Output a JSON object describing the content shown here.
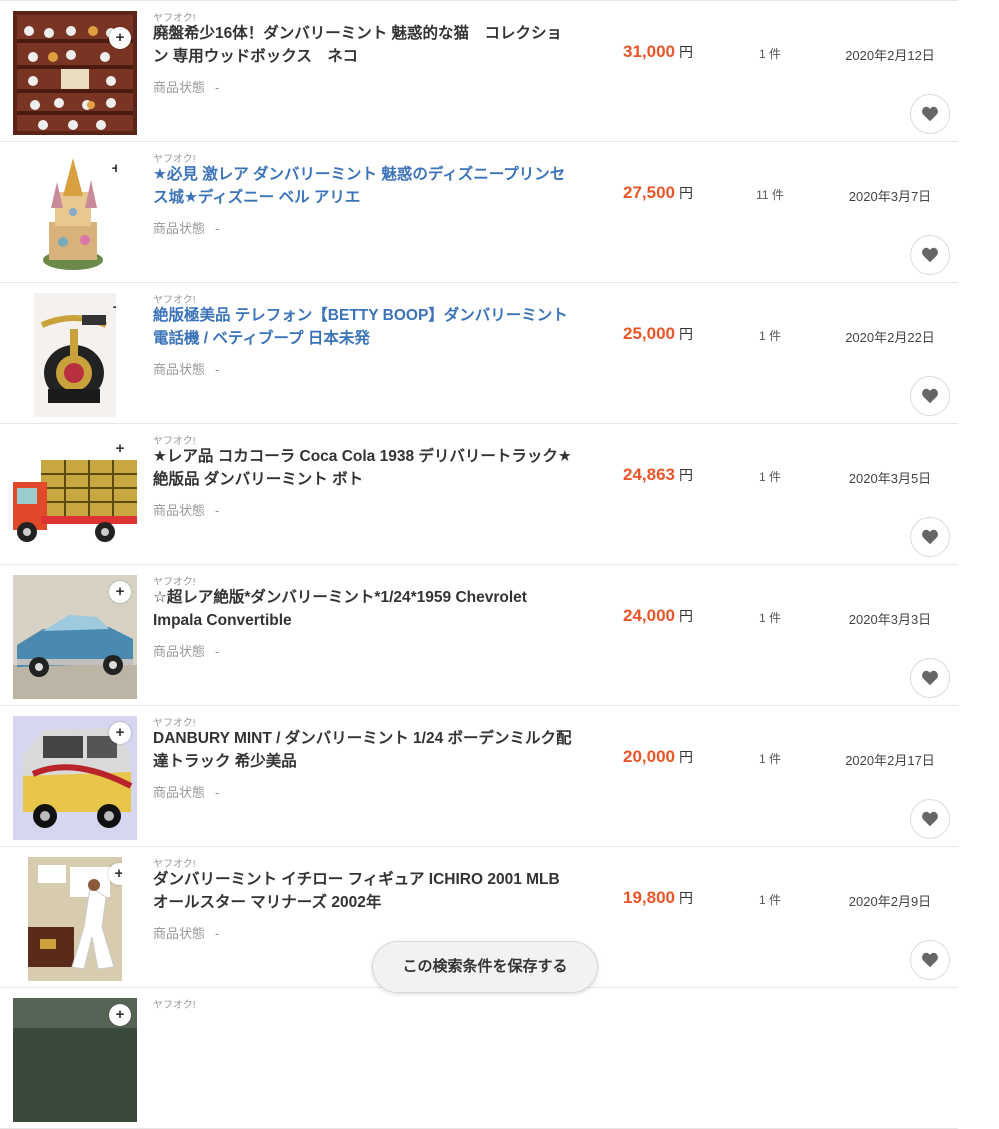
{
  "items": [
    {
      "source": "ヤフオク!",
      "title": "廃盤希少16体！ダンバリーミント 魅惑的な猫　コレクション 専用ウッドボックス　ネコ",
      "cond_label": "商品状態",
      "cond_value": "-",
      "price": "31,000",
      "yen": "円",
      "bids": "1 件",
      "date": "2020年2月12日"
    },
    {
      "source": "ヤフオク!",
      "title": "★必見 激レア ダンバリーミント 魅惑のディズニープリンセス城★ディズニー ベル アリエ",
      "cond_label": "商品状態",
      "cond_value": "-",
      "price": "27,500",
      "yen": "円",
      "bids": "11 件",
      "date": "2020年3月7日"
    },
    {
      "source": "ヤフオク!",
      "title": "絶版極美品 テレフォン【BETTY BOOP】ダンバリーミント 電話機 / ベティブープ 日本未発",
      "cond_label": "商品状態",
      "cond_value": "-",
      "price": "25,000",
      "yen": "円",
      "bids": "1 件",
      "date": "2020年2月22日"
    },
    {
      "source": "ヤフオク!",
      "title": "★レア品 コカコーラ Coca Cola 1938 デリバリートラック★絶版品 ダンバリーミント ボト",
      "cond_label": "商品状態",
      "cond_value": "-",
      "price": "24,863",
      "yen": "円",
      "bids": "1 件",
      "date": "2020年3月5日"
    },
    {
      "source": "ヤフオク!",
      "title": "☆超レア絶版*ダンバリーミント*1/24*1959 Chevrolet Impala Convertible",
      "cond_label": "商品状態",
      "cond_value": "-",
      "price": "24,000",
      "yen": "円",
      "bids": "1 件",
      "date": "2020年3月3日"
    },
    {
      "source": "ヤフオク!",
      "title": "DANBURY MINT / ダンバリーミント 1/24 ボーデンミルク配達トラック 希少美品",
      "cond_label": "商品状態",
      "cond_value": "-",
      "price": "20,000",
      "yen": "円",
      "bids": "1 件",
      "date": "2020年2月17日"
    },
    {
      "source": "ヤフオク!",
      "title": "ダンバリーミント イチロー フィギュア ICHIRO 2001 MLB オールスター マリナーズ 2002年",
      "cond_label": "商品状態",
      "cond_value": "-",
      "price": "19,800",
      "yen": "円",
      "bids": "1 件",
      "date": "2020年2月9日"
    },
    {
      "source": "ヤフオク!"
    }
  ],
  "save_button": "この検索条件を保存する",
  "colors": {
    "price": "#e8562a",
    "link": "#3b73b9",
    "border": "#e6e6e6"
  }
}
